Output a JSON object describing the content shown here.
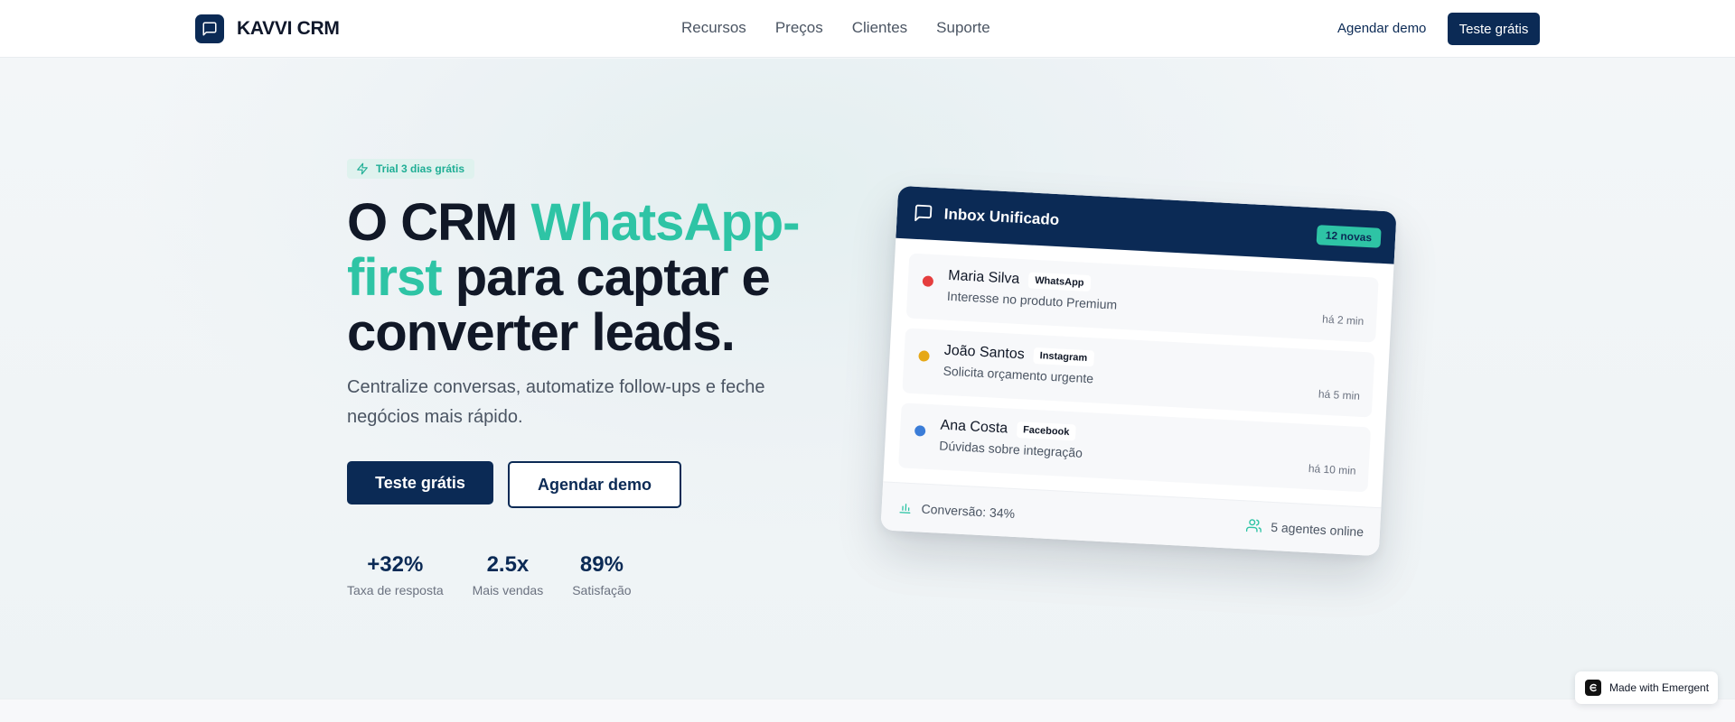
{
  "header": {
    "brand": "KAVVI CRM",
    "nav": [
      "Recursos",
      "Preços",
      "Clientes",
      "Suporte"
    ],
    "demo_link": "Agendar demo",
    "trial_button": "Teste grátis"
  },
  "hero": {
    "badge": "Trial 3 dias grátis",
    "title_part1": "O CRM ",
    "title_accent": "WhatsApp-first",
    "title_part2": " para captar e converter leads.",
    "subtitle": "Centralize conversas, automatize follow-ups e feche negócios mais rápido.",
    "primary_button": "Teste grátis",
    "secondary_button": "Agendar demo",
    "stats": [
      {
        "value": "+32%",
        "label": "Taxa de resposta"
      },
      {
        "value": "2.5x",
        "label": "Mais vendas"
      },
      {
        "value": "89%",
        "label": "Satisfação"
      }
    ]
  },
  "inbox": {
    "title": "Inbox Unificado",
    "new_badge": "12 novas",
    "messages": [
      {
        "name": "Maria Silva",
        "channel": "WhatsApp",
        "text": "Interesse no produto Premium",
        "time": "há 2 min",
        "dot_color": "#e53e3e"
      },
      {
        "name": "João Santos",
        "channel": "Instagram",
        "text": "Solicita orçamento urgente",
        "time": "há 5 min",
        "dot_color": "#e6a817"
      },
      {
        "name": "Ana Costa",
        "channel": "Facebook",
        "text": "Dúvidas sobre integração",
        "time": "há 10 min",
        "dot_color": "#3b7dd8"
      }
    ],
    "conversion": "Conversão: 34%",
    "agents": "5 agentes online"
  },
  "footer_badge": {
    "text": "Made with Emergent"
  },
  "colors": {
    "navy": "#0b2a55",
    "teal": "#2ec4a5"
  },
  "icons": [
    "chat-bubble-icon",
    "lightning-icon",
    "bar-chart-icon",
    "users-icon",
    "emergent-logo-icon"
  ]
}
